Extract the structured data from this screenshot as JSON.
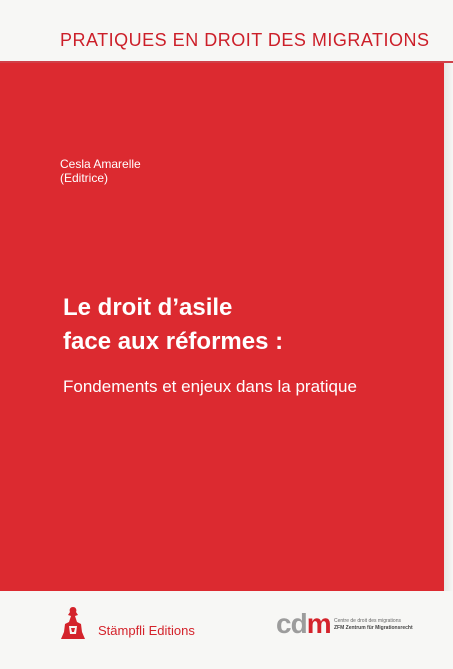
{
  "cover": {
    "series_title": "PRATIQUES EN DROIT DES MIGRATIONS",
    "author": "Cesla Amarelle",
    "author_role": "(Editrice)",
    "title_line1": "Le droit d’asile",
    "title_line2": "face aux réformes :",
    "subtitle": "Fondements et enjeux dans la pratique",
    "publisher": "Stämpfli Editions",
    "partner_logo_cd": "cd",
    "partner_logo_m": "m",
    "partner_line1": "Centre de droit des migrations",
    "partner_line2": "ZFM Zentrum für Migrationsrecht"
  },
  "colors": {
    "accent_red": "#dc2a30",
    "text_red": "#cc1f29",
    "logo_grey": "#9c9c9c"
  },
  "icons": {
    "publisher_logo": "stampfli-figure-icon"
  }
}
